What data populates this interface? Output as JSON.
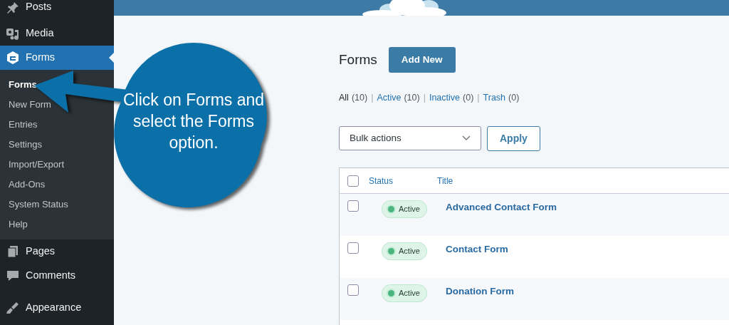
{
  "sidebar": {
    "items": [
      {
        "label": "Posts",
        "selected": false
      },
      {
        "label": "Media",
        "selected": false
      },
      {
        "label": "Forms",
        "selected": true,
        "children": [
          {
            "label": "Forms",
            "selected": true
          },
          {
            "label": "New Form",
            "selected": false
          },
          {
            "label": "Entries",
            "selected": false
          },
          {
            "label": "Settings",
            "selected": false
          },
          {
            "label": "Import/Export",
            "selected": false
          },
          {
            "label": "Add-Ons",
            "selected": false
          },
          {
            "label": "System Status",
            "selected": false
          },
          {
            "label": "Help",
            "selected": false
          }
        ]
      },
      {
        "label": "Pages",
        "selected": false
      },
      {
        "label": "Comments",
        "selected": false
      },
      {
        "label": "Appearance",
        "selected": false
      }
    ]
  },
  "page": {
    "title": "Forms",
    "add_button": "Add New",
    "filters": [
      {
        "label": "All",
        "count": "(10)",
        "selected": true
      },
      {
        "label": "Active",
        "count": "(10)",
        "selected": false
      },
      {
        "label": "Inactive",
        "count": "(0)",
        "selected": false
      },
      {
        "label": "Trash",
        "count": "(0)",
        "selected": false
      }
    ],
    "filter_separators": [
      "|",
      "|",
      "|"
    ],
    "bulk_select": "Bulk actions",
    "apply_button": "Apply",
    "table": {
      "columns": [
        "Status",
        "Title"
      ],
      "select_all_checked": false,
      "rows": [
        {
          "checked": false,
          "status": "Active",
          "title": "Advanced Contact Form"
        },
        {
          "checked": false,
          "status": "Active",
          "title": "Contact Form"
        },
        {
          "checked": false,
          "status": "Active",
          "title": "Donation Form"
        }
      ]
    }
  },
  "callout": {
    "text": "Click on Forms and select the Forms option."
  }
}
